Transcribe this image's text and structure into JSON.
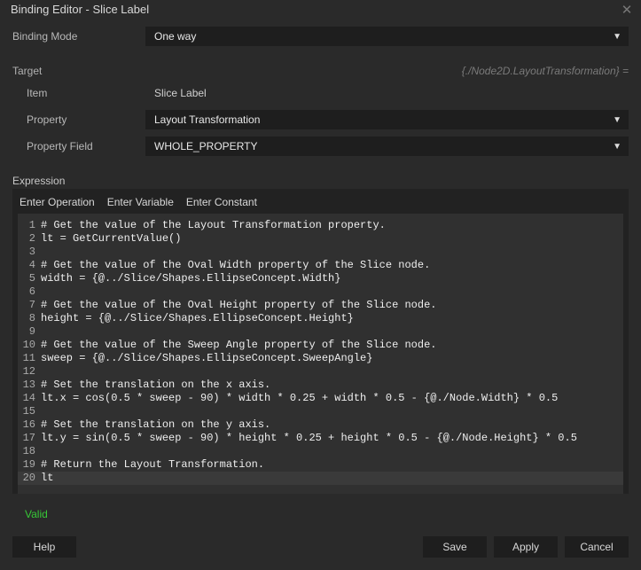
{
  "title": "Binding Editor - Slice Label",
  "bindingMode": {
    "label": "Binding Mode",
    "value": "One way"
  },
  "target": {
    "label": "Target",
    "pathSummary": "{./Node2D.LayoutTransformation} =",
    "itemLabel": "Item",
    "itemValue": "Slice Label",
    "propertyLabel": "Property",
    "propertyValue": "Layout Transformation",
    "fieldLabel": "Property Field",
    "fieldValue": "WHOLE_PROPERTY"
  },
  "expression": {
    "label": "Expression",
    "buttons": {
      "op": "Enter Operation",
      "var": "Enter Variable",
      "const": "Enter Constant"
    },
    "lines": [
      "# Get the value of the Layout Transformation property.",
      "lt = GetCurrentValue()",
      "",
      "# Get the value of the Oval Width property of the Slice node.",
      "width = {@../Slice/Shapes.EllipseConcept.Width}",
      "",
      "# Get the value of the Oval Height property of the Slice node.",
      "height = {@../Slice/Shapes.EllipseConcept.Height}",
      "",
      "# Get the value of the Sweep Angle property of the Slice node.",
      "sweep = {@../Slice/Shapes.EllipseConcept.SweepAngle}",
      "",
      "# Set the translation on the x axis.",
      "lt.x = cos(0.5 * sweep - 90) * width * 0.25 + width * 0.5 - {@./Node.Width} * 0.5",
      "",
      "# Set the translation on the y axis.",
      "lt.y = sin(0.5 * sweep - 90) * height * 0.25 + height * 0.5 - {@./Node.Height} * 0.5",
      "",
      "# Return the Layout Transformation.",
      "lt"
    ],
    "status": "Valid"
  },
  "footer": {
    "help": "Help",
    "save": "Save",
    "apply": "Apply",
    "cancel": "Cancel"
  }
}
